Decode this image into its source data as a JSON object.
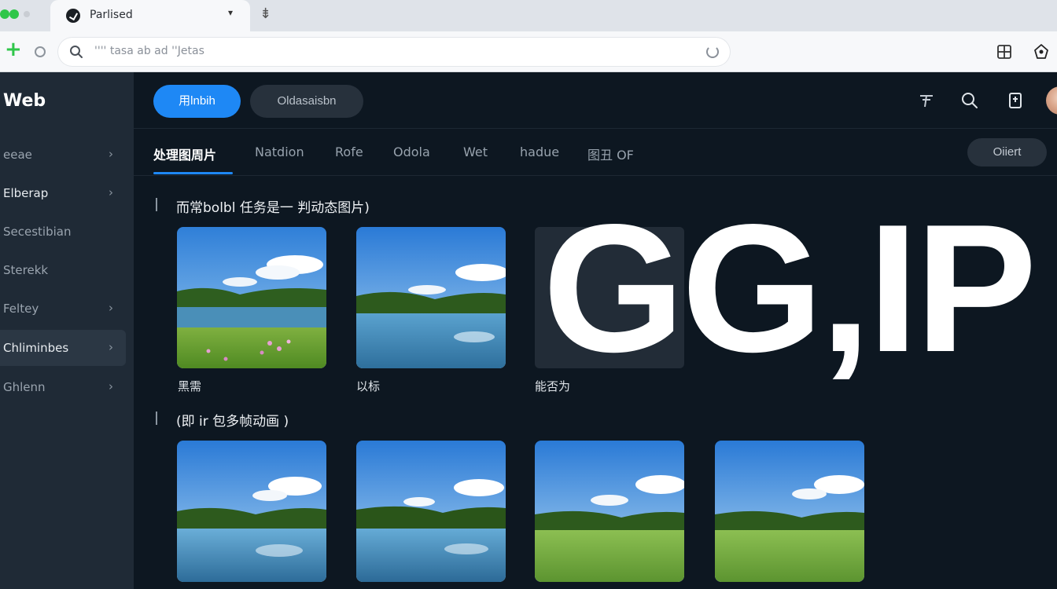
{
  "browser": {
    "tab_title": "Parlised",
    "tab_close": "▾",
    "newtab_glyph": "⇟",
    "address_text": "'''' tasa ab ad ''Jetas"
  },
  "sidebar": {
    "brand": "Web",
    "items": [
      {
        "label": "eeae",
        "chevron": "›"
      },
      {
        "label": "Elberap",
        "chevron": "›"
      },
      {
        "label": "Secestibian",
        "chevron": ""
      },
      {
        "label": "Sterekk",
        "chevron": ""
      },
      {
        "label": "Feltey",
        "chevron": "›"
      },
      {
        "label": "Chliminbes",
        "chevron": "›"
      },
      {
        "label": "Ghlenn",
        "chevron": "›"
      }
    ]
  },
  "header": {
    "primary_button": "用lnbih",
    "secondary_button": "Oldasaisbn"
  },
  "tabs": {
    "items": [
      "处理图周片",
      "Natdion",
      "Rofe",
      "Odola",
      "Wet",
      "hadue",
      "图丑  OF"
    ],
    "filter_button": "Oiiert"
  },
  "sections": {
    "first_title": "而常bolbl 任务是一 判动态图片)",
    "second_title": "(即 ir 包多帧动画 )",
    "captions": [
      "黑需",
      "以标",
      "能否为"
    ]
  },
  "overlay_text": "GG,IP",
  "colors": {
    "accent": "#1e88f5",
    "sidebar_bg": "#1f2a36",
    "main_bg": "#0d1721",
    "green": "#2fc64a"
  }
}
